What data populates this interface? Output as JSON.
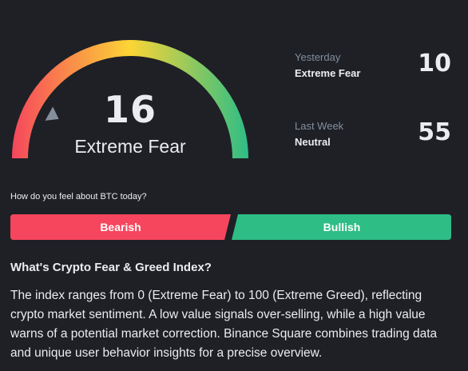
{
  "gauge": {
    "value": "16",
    "level": 16,
    "label": "Extreme Fear",
    "colors": {
      "fear": "#f6465d",
      "neutral": "#fcd535",
      "greed": "#2ebd85",
      "marker": "#848e9c"
    }
  },
  "history": {
    "yesterday": {
      "period": "Yesterday",
      "classification": "Extreme Fear",
      "value": "10"
    },
    "last_week": {
      "period": "Last Week",
      "classification": "Neutral",
      "value": "55"
    }
  },
  "sentiment": {
    "question": "How do you feel about BTC today?",
    "bearish_label": "Bearish",
    "bullish_label": "Bullish",
    "colors": {
      "bearish": "#f6465d",
      "bullish": "#2ebd85"
    }
  },
  "info": {
    "title": "What's Crypto Fear & Greed Index?",
    "body": "The index ranges from 0 (Extreme Fear) to 100 (Extreme Greed), reflecting crypto market sentiment. A low value signals over-selling, while a high value warns of a potential market correction. Binance Square combines trading data and unique user behavior insights for a precise overview."
  }
}
